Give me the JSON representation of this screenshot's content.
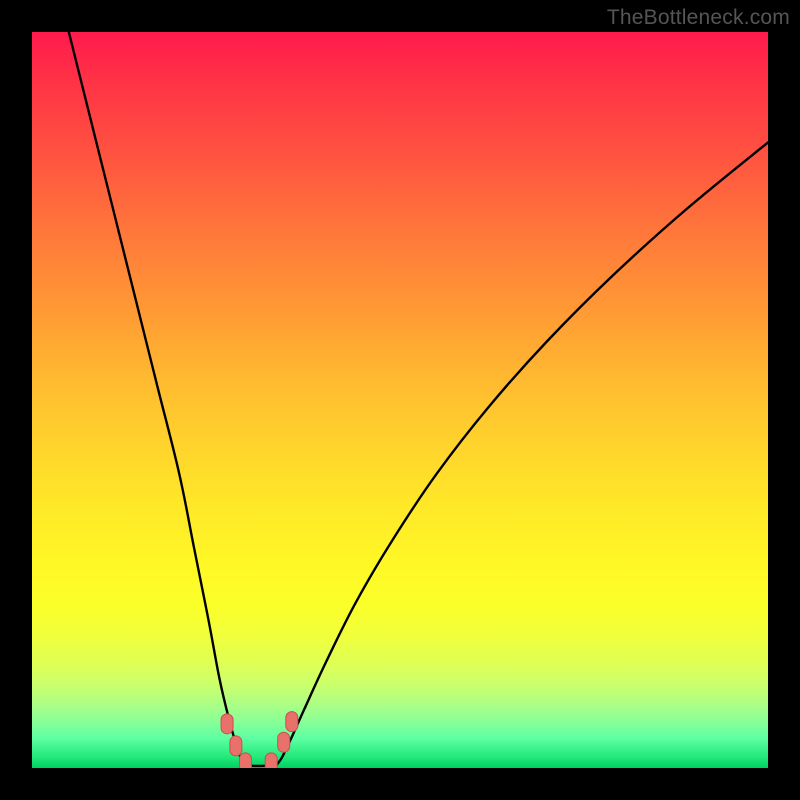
{
  "watermark": "TheBottleneck.com",
  "chart_data": {
    "type": "line",
    "title": "",
    "xlabel": "",
    "ylabel": "",
    "xlim": [
      0,
      100
    ],
    "ylim": [
      0,
      100
    ],
    "grid": false,
    "legend": false,
    "annotations": [],
    "background_gradient": {
      "orientation": "vertical",
      "stops": [
        {
          "pos": 0.0,
          "color": "#ff1a4d"
        },
        {
          "pos": 0.4,
          "color": "#ff9a34"
        },
        {
          "pos": 0.7,
          "color": "#fff726"
        },
        {
          "pos": 0.88,
          "color": "#ccff6a"
        },
        {
          "pos": 1.0,
          "color": "#00d060"
        }
      ]
    },
    "series": [
      {
        "name": "curve-left",
        "x": [
          5,
          8,
          11,
          14,
          17,
          20,
          22,
          24,
          25.5,
          26.8,
          27.8,
          28.4,
          28.7
        ],
        "y": [
          100,
          88,
          76,
          64,
          52,
          40,
          30,
          20,
          12,
          6.5,
          3,
          1.2,
          0.5
        ]
      },
      {
        "name": "curve-right",
        "x": [
          33.3,
          34.0,
          35.2,
          37,
          40,
          44,
          49,
          55,
          62,
          70,
          79,
          89,
          100
        ],
        "y": [
          0.5,
          1.5,
          4,
          8,
          14.5,
          22.5,
          31,
          40,
          49,
          58,
          67,
          76,
          85
        ]
      },
      {
        "name": "flat-bottom",
        "x": [
          28.7,
          30.0,
          31.5,
          33.3
        ],
        "y": [
          0.5,
          0.3,
          0.3,
          0.5
        ]
      }
    ],
    "markers": [
      {
        "name": "m1",
        "x": 26.5,
        "y": 6.0
      },
      {
        "name": "m2",
        "x": 27.7,
        "y": 3.0
      },
      {
        "name": "m3",
        "x": 29.0,
        "y": 0.7
      },
      {
        "name": "m4",
        "x": 32.5,
        "y": 0.7
      },
      {
        "name": "m5",
        "x": 34.2,
        "y": 3.5
      },
      {
        "name": "m6",
        "x": 35.3,
        "y": 6.3
      }
    ],
    "marker_style": {
      "color": "#e9716b",
      "stroke": "#c94f49"
    }
  }
}
